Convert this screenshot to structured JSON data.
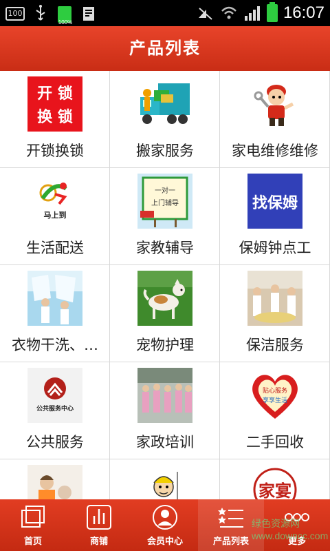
{
  "status_bar": {
    "left_badge": "100",
    "battery_small_pct": "100%",
    "time": "16:07"
  },
  "header": {
    "title": "产品列表"
  },
  "thumb_texts": {
    "unlock": [
      "开 锁",
      "换 锁"
    ],
    "logistics": "马上到",
    "tutor": [
      "一对一",
      "上门辅导"
    ],
    "nanny": "找保姆",
    "public": "公共服务中心",
    "second_hand": [
      "贴心服务",
      "享享生活"
    ],
    "last": "家宴"
  },
  "grid": {
    "items": [
      {
        "label": "开锁换锁",
        "icon": "unlock-icon"
      },
      {
        "label": "搬家服务",
        "icon": "moving-truck-icon"
      },
      {
        "label": "家电维修维修",
        "icon": "repairman-icon"
      },
      {
        "label": "生活配送",
        "icon": "delivery-icon"
      },
      {
        "label": "家教辅导",
        "icon": "tutor-board-icon"
      },
      {
        "label": "保姆钟点工",
        "icon": "nanny-icon"
      },
      {
        "label": "衣物干洗、…",
        "icon": "laundry-photo-icon"
      },
      {
        "label": "宠物护理",
        "icon": "dog-photo-icon"
      },
      {
        "label": "保洁服务",
        "icon": "cleaning-photo-icon"
      },
      {
        "label": "公共服务",
        "icon": "public-service-icon"
      },
      {
        "label": "家政培训",
        "icon": "training-photo-icon"
      },
      {
        "label": "二手回收",
        "icon": "heart-badge-icon"
      },
      {
        "label": "",
        "icon": "elder-care-photo-icon"
      },
      {
        "label": "",
        "icon": "cartoon-cleaner-icon"
      },
      {
        "label": "",
        "icon": "family-banquet-icon"
      }
    ]
  },
  "bottom_nav": {
    "items": [
      {
        "label": "首页",
        "icon": "home-icon"
      },
      {
        "label": "商铺",
        "icon": "shop-icon"
      },
      {
        "label": "会员中心",
        "icon": "member-icon"
      },
      {
        "label": "产品列表",
        "icon": "product-list-icon"
      },
      {
        "label": "更多",
        "icon": "more-icon"
      }
    ],
    "active_index": 3
  },
  "watermark": "绿色资源网 www.downcc.com",
  "colors": {
    "header_red": "#d8361c",
    "nav_red": "#d23318",
    "battery_green": "#2ecc40",
    "grid_line": "#d8d8d8"
  }
}
